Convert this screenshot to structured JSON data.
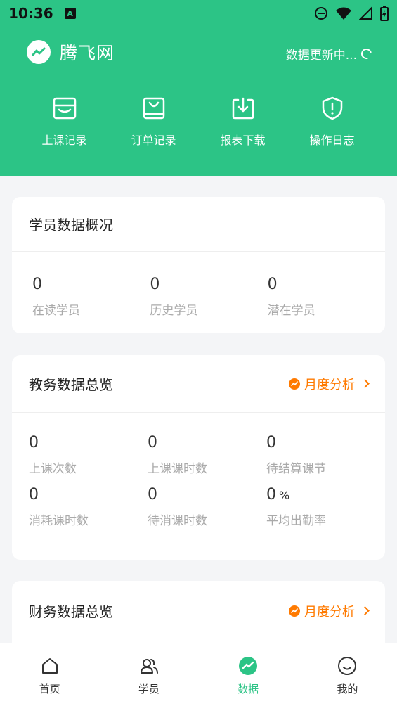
{
  "status_bar": {
    "time": "10:36",
    "a_badge": "A"
  },
  "header": {
    "brand_name": "腾飞网",
    "sync_text": "数据更新中...",
    "quick_actions": [
      {
        "label": "上课记录",
        "icon": "inbox-icon"
      },
      {
        "label": "订单记录",
        "icon": "bag-icon"
      },
      {
        "label": "报表下载",
        "icon": "download-icon"
      },
      {
        "label": "操作日志",
        "icon": "shield-icon"
      }
    ]
  },
  "student_card": {
    "title": "学员数据概况",
    "stats": [
      {
        "value": "0",
        "label": "在读学员"
      },
      {
        "value": "0",
        "label": "历史学员"
      },
      {
        "value": "0",
        "label": "潜在学员"
      }
    ]
  },
  "academic_card": {
    "title": "教务数据总览",
    "monthly_label": "月度分析",
    "stats": [
      {
        "value": "0",
        "label": "上课次数"
      },
      {
        "value": "0",
        "label": "上课课时数"
      },
      {
        "value": "0",
        "label": "待结算课节"
      },
      {
        "value": "0",
        "label": "消耗课时数"
      },
      {
        "value": "0",
        "label": "待消课时数"
      },
      {
        "value": "0",
        "unit": "%",
        "label": "平均出勤率"
      }
    ]
  },
  "finance_card": {
    "title": "财务数据总览",
    "monthly_label": "月度分析"
  },
  "tabbar": {
    "items": [
      {
        "label": "首页",
        "icon": "home-icon"
      },
      {
        "label": "学员",
        "icon": "users-icon"
      },
      {
        "label": "数据",
        "icon": "chart-icon"
      },
      {
        "label": "我的",
        "icon": "smiley-icon"
      }
    ],
    "active_index": 2
  },
  "colors": {
    "brand": "#2cc486",
    "accent": "#ff7a00"
  }
}
